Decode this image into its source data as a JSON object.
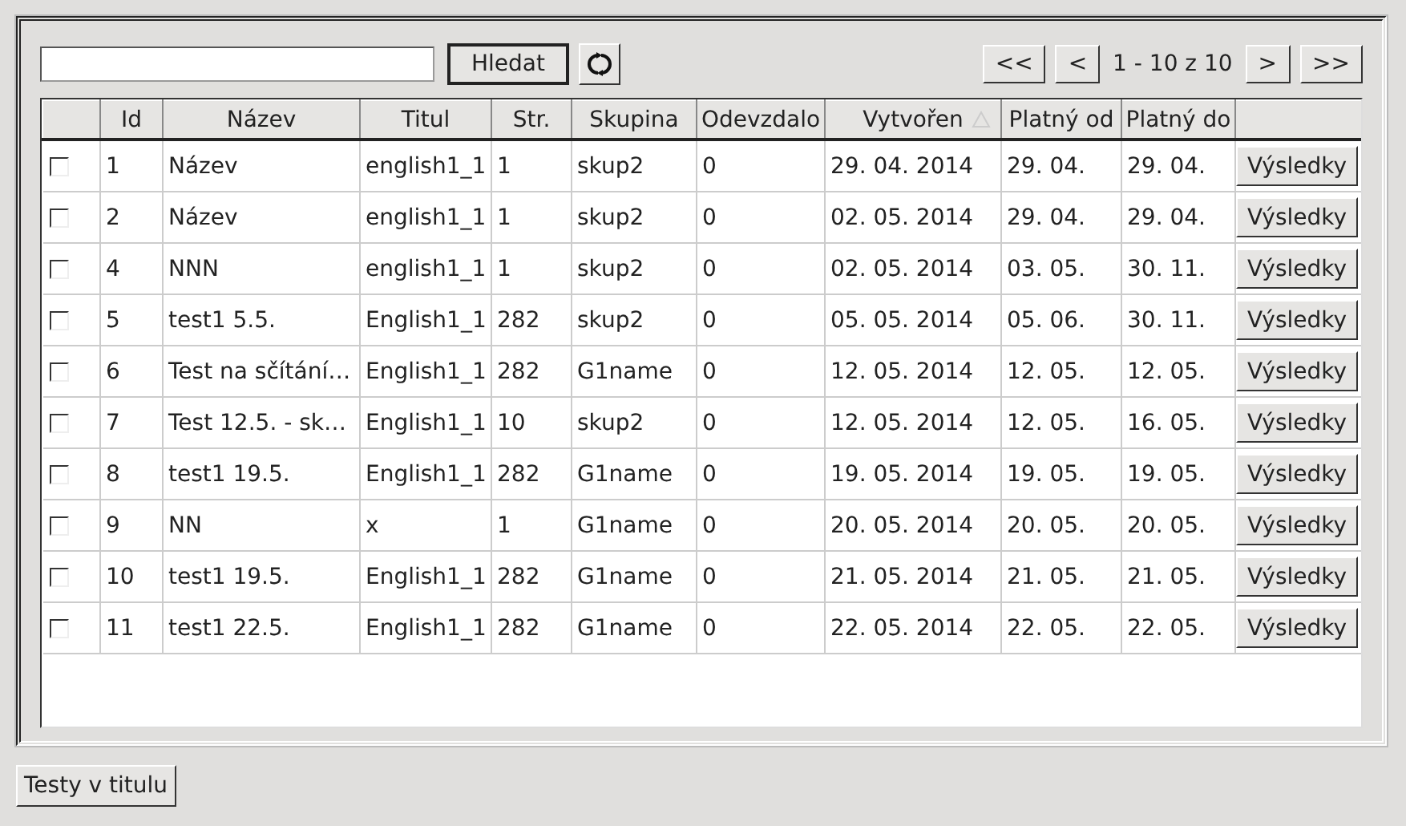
{
  "search": {
    "button": "Hledat"
  },
  "pager": {
    "first": "<<",
    "prev": "<",
    "info": "1 - 10 z 10",
    "next": ">",
    "last": ">>"
  },
  "table": {
    "columns": [
      {
        "sorted": false
      },
      {
        "label": "Id",
        "sorted": false
      },
      {
        "label": "Název",
        "sorted": false
      },
      {
        "label": "Titul",
        "sorted": false
      },
      {
        "label": "Str.",
        "sorted": false
      },
      {
        "label": "Skupina",
        "sorted": false
      },
      {
        "label": "Odevzdalo",
        "sorted": false
      },
      {
        "label": "Vytvořen",
        "sorted": true
      },
      {
        "label": "Platný od",
        "sorted": false
      },
      {
        "label": "Platný do",
        "sorted": false
      },
      {
        "sorted": false
      }
    ],
    "rows": [
      {
        "checked": false,
        "id": "1",
        "name": "Název",
        "title": "english1_1",
        "pages": "1",
        "group": "skup2",
        "submitted": "0",
        "created": "29. 04. 2014",
        "from": "29. 04.",
        "to": "29. 04.",
        "action": "Výsledky"
      },
      {
        "checked": false,
        "id": "2",
        "name": "Název",
        "title": "english1_1",
        "pages": "1",
        "group": "skup2",
        "submitted": "0",
        "created": "02. 05. 2014",
        "from": "29. 04.",
        "to": "29. 04.",
        "action": "Výsledky"
      },
      {
        "checked": false,
        "id": "4",
        "name": "NNN",
        "title": "english1_1",
        "pages": "1",
        "group": "skup2",
        "submitted": "0",
        "created": "02. 05. 2014",
        "from": "03. 05.",
        "to": "30. 11.",
        "action": "Výsledky"
      },
      {
        "checked": false,
        "id": "5",
        "name": "test1 5.5.",
        "title": "English1_1",
        "pages": "282",
        "group": "skup2",
        "submitted": "0",
        "created": "05. 05. 2014",
        "from": "05. 06.",
        "to": "30. 11.",
        "action": "Výsledky"
      },
      {
        "checked": false,
        "id": "6",
        "name": "Test na sčítání…",
        "title": "English1_1",
        "pages": "282",
        "group": "G1name",
        "submitted": "0",
        "created": "12. 05. 2014",
        "from": "12. 05.",
        "to": "12. 05.",
        "action": "Výsledky"
      },
      {
        "checked": false,
        "id": "7",
        "name": "Test 12.5. - sk…",
        "title": "English1_1",
        "pages": "10",
        "group": "skup2",
        "submitted": "0",
        "created": "12. 05. 2014",
        "from": "12. 05.",
        "to": "16. 05.",
        "action": "Výsledky"
      },
      {
        "checked": false,
        "id": "8",
        "name": "test1 19.5.",
        "title": "English1_1",
        "pages": "282",
        "group": "G1name",
        "submitted": "0",
        "created": "19. 05. 2014",
        "from": "19. 05.",
        "to": "19. 05.",
        "action": "Výsledky"
      },
      {
        "checked": false,
        "id": "9",
        "name": "NN",
        "title": "x",
        "pages": "1",
        "group": "G1name",
        "submitted": "0",
        "created": "20. 05. 2014",
        "from": "20. 05.",
        "to": "20. 05.",
        "action": "Výsledky"
      },
      {
        "checked": false,
        "id": "10",
        "name": "test1 19.5.",
        "title": "English1_1",
        "pages": "282",
        "group": "G1name",
        "submitted": "0",
        "created": "21. 05. 2014",
        "from": "21. 05.",
        "to": "21. 05.",
        "action": "Výsledky"
      },
      {
        "checked": false,
        "id": "11",
        "name": "test1 22.5.",
        "title": "English1_1",
        "pages": "282",
        "group": "G1name",
        "submitted": "0",
        "created": "22. 05. 2014",
        "from": "22. 05.",
        "to": "22. 05.",
        "action": "Výsledky"
      }
    ]
  },
  "footer_button": "Testy v titulu"
}
